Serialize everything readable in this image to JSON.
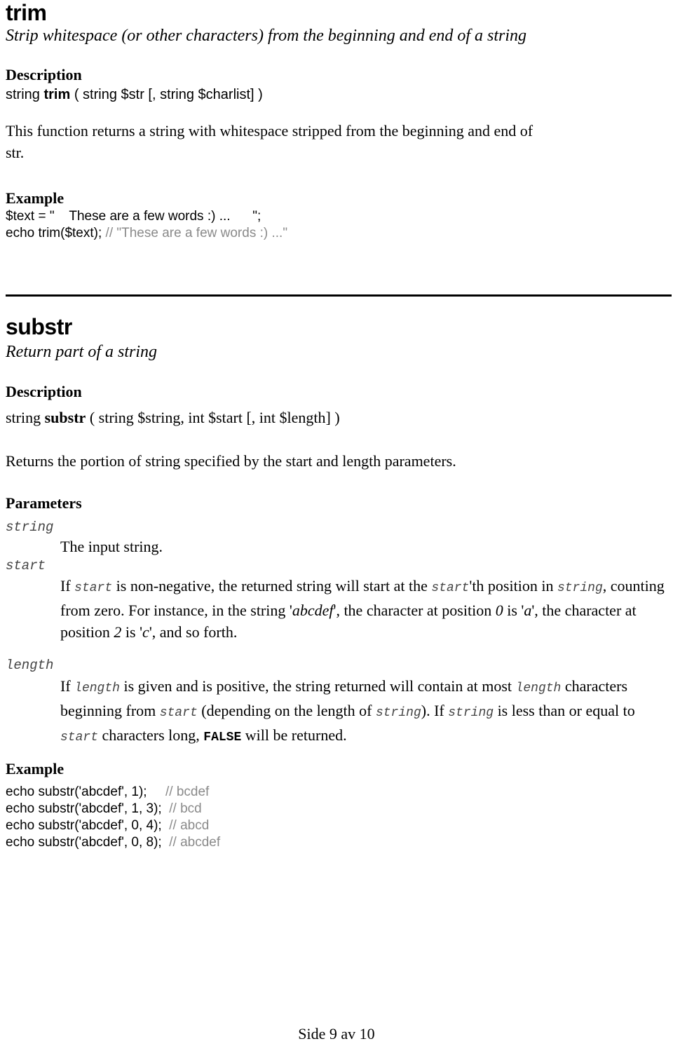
{
  "trim": {
    "title": "trim",
    "tagline": "Strip whitespace (or other characters) from the beginning and end of a string",
    "description_heading": "Description",
    "signature": {
      "return_type": "string",
      "name": "trim",
      "params": "( string $str [, string $charlist] )"
    },
    "description_text_line1": "This function returns a string with whitespace stripped from the beginning and end of",
    "description_text_line2": "str.",
    "example_heading": "Example",
    "example_lines": [
      {
        "code": "$text = \"    These are a few words :) ...      \";",
        "comment": ""
      },
      {
        "code": "echo trim($text); ",
        "comment": "// \"These are a few words :) ...\""
      }
    ]
  },
  "substr": {
    "title": "substr",
    "tagline": "Return part of a string",
    "description_heading": "Description",
    "signature": {
      "return_type": "string",
      "name": "substr",
      "params": "( string $string, int $start [, int $length] )"
    },
    "description_text": "Returns the portion of string specified by the start and length parameters.",
    "parameters_heading": "Parameters",
    "parameters": [
      {
        "name": "string",
        "description": "The input string."
      },
      {
        "name": "start",
        "description_parts": {
          "p1": "If ",
          "m1": "start",
          "p2": " is non-negative, the returned string will start at the ",
          "m2": "start",
          "p3": "'th position in ",
          "m3": "string",
          "p4": ", counting from zero. For instance, in the string '",
          "i1": "abcdef",
          "p5": "', the character at position ",
          "i2": "0",
          "p6": " is '",
          "i3": "a",
          "p7": "', the character at position ",
          "i4": "2",
          "p8": " is '",
          "i5": "c",
          "p9": "', and so forth."
        }
      },
      {
        "name": "length",
        "description_parts": {
          "p1": "If ",
          "m1": "length",
          "p2": " is given and is positive, the string returned will contain at most ",
          "m2": "length",
          "p3": " characters beginning from ",
          "m3": "start",
          "p4": " (depending on the length of ",
          "m4": "string",
          "p5": "). If ",
          "m5": "string",
          "p6": " is less than or equal to ",
          "m6": "start",
          "p7": " characters long, ",
          "c1": "FALSE",
          "p8": " will be returned."
        }
      }
    ],
    "example_heading": "Example",
    "example_lines": [
      {
        "code": "echo substr('abcdef', 1);     ",
        "comment": "// bcdef"
      },
      {
        "code": "echo substr('abcdef', 1, 3);  ",
        "comment": "// bcd"
      },
      {
        "code": "echo substr('abcdef', 0, 4);  ",
        "comment": "// abcd"
      },
      {
        "code": "echo substr('abcdef', 0, 8);  ",
        "comment": "// abcdef"
      }
    ]
  },
  "footer": {
    "page_label": "Side 9 av 10"
  }
}
